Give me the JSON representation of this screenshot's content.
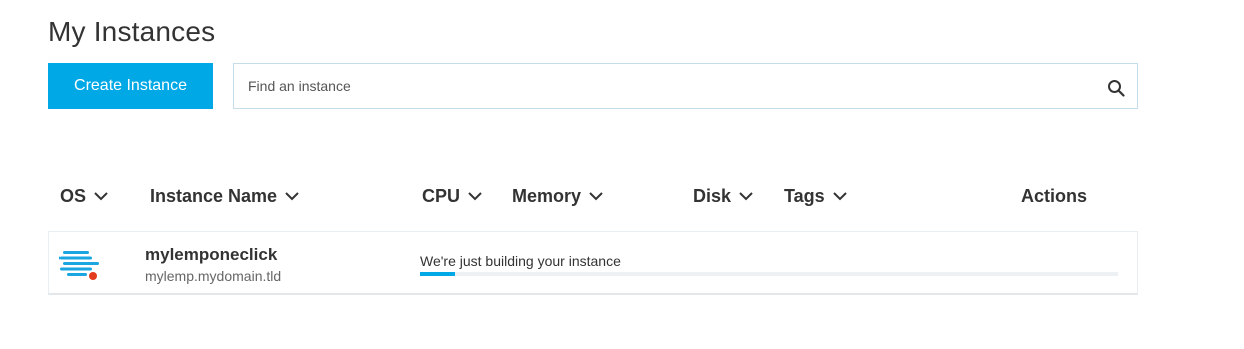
{
  "page": {
    "title": "My Instances"
  },
  "toolbar": {
    "create_label": "Create Instance",
    "search_placeholder": "Find an instance"
  },
  "columns": [
    {
      "label": "OS",
      "sortable": true
    },
    {
      "label": "Instance Name",
      "sortable": true
    },
    {
      "label": "CPU",
      "sortable": true
    },
    {
      "label": "Memory",
      "sortable": true
    },
    {
      "label": "Disk",
      "sortable": true
    },
    {
      "label": "Tags",
      "sortable": true
    },
    {
      "label": "Actions",
      "sortable": false
    }
  ],
  "instances": [
    {
      "os_icon": "lemp-stack-icon",
      "status_color": "#e23b1e",
      "name": "mylemponeclick",
      "hostname": "mylemp.mydomain.tld",
      "status_text": "We're just building your instance",
      "progress": 0.05
    }
  ],
  "colors": {
    "accent": "#00a8e6",
    "text": "#333333",
    "muted": "#666666",
    "status_dot": "#e23b1e"
  }
}
